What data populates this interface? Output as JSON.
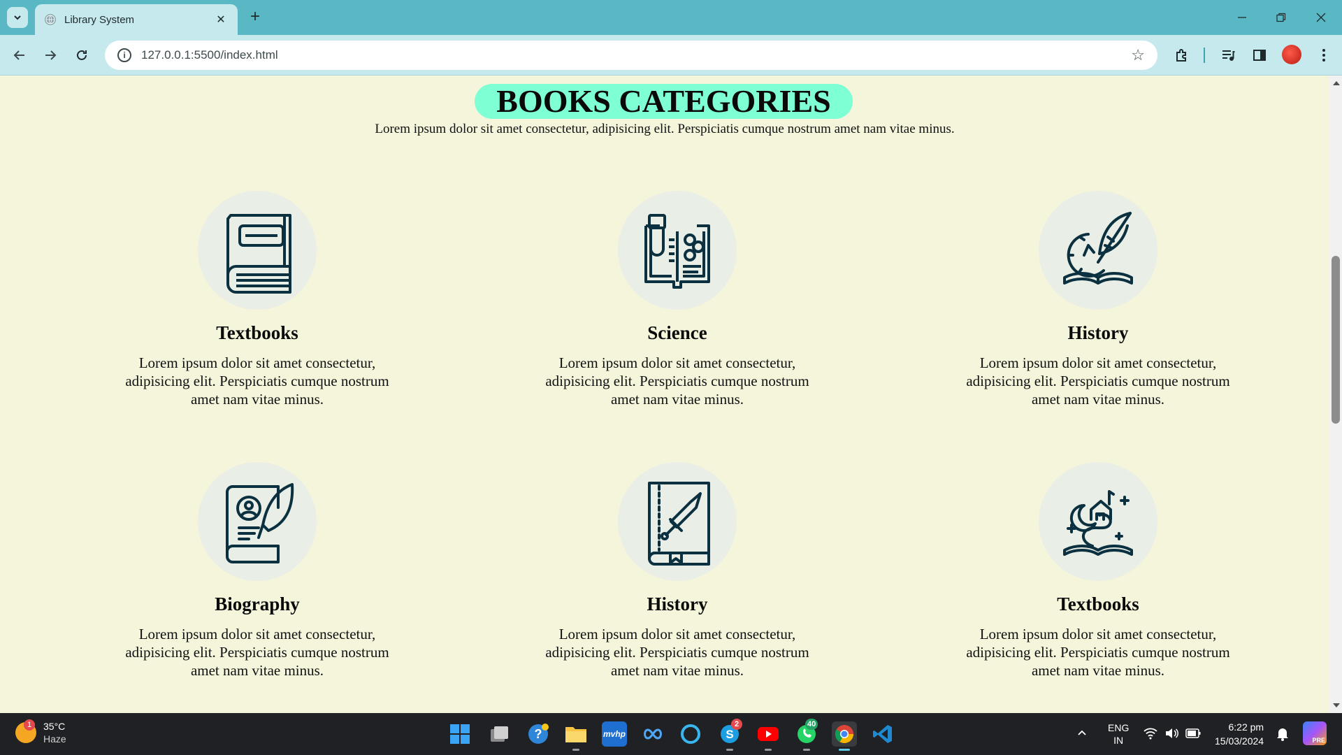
{
  "browser": {
    "tab_title": "Library System",
    "tab_close": "✕",
    "new_tab": "+",
    "url": "127.0.0.1:5500/index.html"
  },
  "page": {
    "heading": "BOOKS CATEGORIES",
    "intro": "Lorem ipsum dolor sit amet consectetur, adipisicing elit. Perspiciatis cumque nostrum amet nam vitae minus.",
    "accent_color": "#7fffd4",
    "background_color": "#f5f5dc",
    "categories": [
      {
        "title": "Textbooks",
        "icon": "textbook-icon",
        "text": "Lorem ipsum dolor sit amet consectetur, adipisicing elit. Perspiciatis cumque nostrum amet nam vitae minus."
      },
      {
        "title": "Science",
        "icon": "science-book-icon",
        "text": "Lorem ipsum dolor sit amet consectetur, adipisicing elit. Perspiciatis cumque nostrum amet nam vitae minus."
      },
      {
        "title": "History",
        "icon": "history-quill-icon",
        "text": "Lorem ipsum dolor sit amet consectetur, adipisicing elit. Perspiciatis cumque nostrum amet nam vitae minus."
      },
      {
        "title": "Biography",
        "icon": "biography-book-icon",
        "text": "Lorem ipsum dolor sit amet consectetur, adipisicing elit. Perspiciatis cumque nostrum amet nam vitae minus."
      },
      {
        "title": "History",
        "icon": "sword-book-icon",
        "text": "Lorem ipsum dolor sit amet consectetur, adipisicing elit. Perspiciatis cumque nostrum amet nam vitae minus."
      },
      {
        "title": "Textbooks",
        "icon": "fantasy-book-icon",
        "text": "Lorem ipsum dolor sit amet consectetur, adipisicing elit. Perspiciatis cumque nostrum amet nam vitae minus."
      }
    ]
  },
  "taskbar": {
    "weather_temp": "35°C",
    "weather_desc": "Haze",
    "weather_badge": "1",
    "skype_badge": "2",
    "whatsapp_badge": "40",
    "lang_top": "ENG",
    "lang_bottom": "IN",
    "time": "6:22 pm",
    "date": "15/03/2024",
    "mcafee_label": "mvhp",
    "pre_label": "PRE"
  }
}
